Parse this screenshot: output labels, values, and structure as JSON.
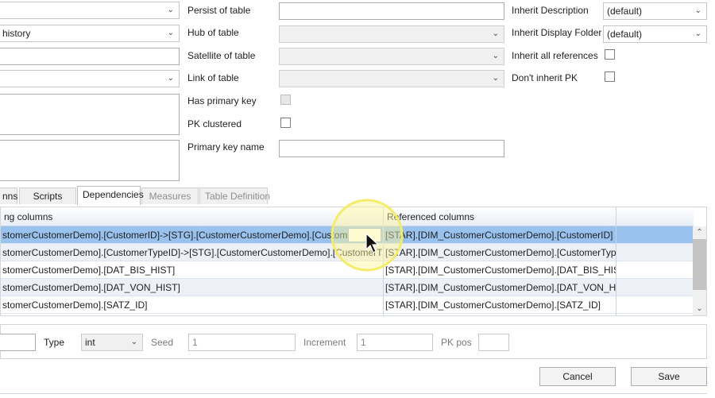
{
  "left_col": {
    "combo_1": "",
    "combo_2": "history",
    "text_3": "",
    "combo_4": ""
  },
  "mid": {
    "persist_label": "Persist of table",
    "hub_label": "Hub of table",
    "satellite_label": "Satellite of table",
    "link_label": "Link of table",
    "has_pk_label": "Has primary key",
    "pk_clustered_label": "PK clustered",
    "pk_name_label": "Primary key name",
    "persist_value": "",
    "hub_value": "",
    "satellite_value": "",
    "link_value": "",
    "pk_name_value": ""
  },
  "right": {
    "inherit_desc_label": "Inherit Description",
    "inherit_desc_value": "(default)",
    "inherit_folder_label": "Inherit Display Folder",
    "inherit_folder_value": "(default)",
    "inherit_refs_label": "Inherit all references",
    "dont_inherit_pk_label": "Don't inherit PK"
  },
  "tabs": [
    {
      "label": "nns"
    },
    {
      "label": "Scripts"
    },
    {
      "label": "Dependencies"
    },
    {
      "label": "Measures"
    },
    {
      "label": "Table Definition"
    }
  ],
  "grid": {
    "col1_header": "ng columns",
    "col2_header": "Referenced columns",
    "rows": [
      {
        "col1": "stomerCustomerDemo].[CustomerID]->[STG].[CustomerCustomerDemo].[CustomerID]",
        "col2": "[STAR].[DIM_CustomerCustomerDemo].[CustomerID]"
      },
      {
        "col1": "stomerCustomerDemo].[CustomerTypeID]->[STG].[CustomerCustomerDemo].[CustomerTypeID]",
        "col2": "[STAR].[DIM_CustomerCustomerDemo].[CustomerTypeID]"
      },
      {
        "col1": "stomerCustomerDemo].[DAT_BIS_HIST]",
        "col2": "[STAR].[DIM_CustomerCustomerDemo].[DAT_BIS_HIST]"
      },
      {
        "col1": "stomerCustomerDemo].[DAT_VON_HIST]",
        "col2": "[STAR].[DIM_CustomerCustomerDemo].[DAT_VON_HIST]"
      },
      {
        "col1": "stomerCustomerDemo].[SATZ_ID]",
        "col2": "[STAR].[DIM_CustomerCustomerDemo].[SATZ_ID]"
      }
    ]
  },
  "bottom": {
    "type_label": "Type",
    "type_value": "int",
    "seed_label": "Seed",
    "seed_value": "1",
    "increment_label": "Increment",
    "increment_value": "1",
    "pk_pos_label": "PK pos",
    "pk_pos_value": ""
  },
  "buttons": {
    "cancel": "Cancel",
    "save": "Save"
  },
  "icons": {
    "chevron": "chevron-down-icon",
    "cursor": "mouse-pointer-icon"
  }
}
